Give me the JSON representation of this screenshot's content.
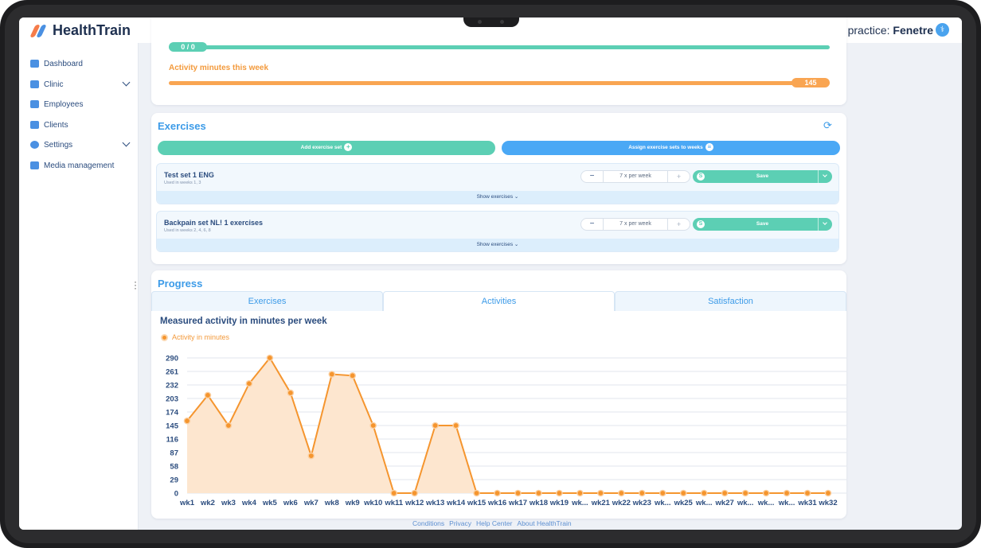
{
  "app": {
    "name": "HealthTrain"
  },
  "practice": {
    "label": "practice:",
    "name": "Fenetre"
  },
  "sidebar": {
    "items": [
      {
        "label": "Dashboard",
        "icon": "dashboard-icon"
      },
      {
        "label": "Clinic",
        "icon": "clinic-icon",
        "expandable": true
      },
      {
        "label": "Employees",
        "icon": "employees-icon"
      },
      {
        "label": "Clients",
        "icon": "clients-icon"
      },
      {
        "label": "Settings",
        "icon": "gear-icon",
        "expandable": true
      },
      {
        "label": "Media management",
        "icon": "media-icon"
      }
    ]
  },
  "goals": {
    "exercise_pill": "0 / 0",
    "exercise_progress": 0,
    "activity_label": "Activity minutes this week",
    "activity_pill": "145",
    "activity_progress": 1
  },
  "exercises": {
    "title": "Exercises",
    "add_label": "Add exercise set",
    "assign_label": "Assign exercise sets to weeks",
    "sets": [
      {
        "name": "Test set 1 ENG",
        "weeks": "Used in weeks 1, 3",
        "frequency": "7 x per week",
        "save_label": "Save",
        "show_label": "Show exercises"
      },
      {
        "name": "Backpain set NL! 1 exercises",
        "weeks": "Used in weeks 2, 4, 6, 8",
        "frequency": "7 x per week",
        "save_label": "Save",
        "show_label": "Show exercises"
      }
    ]
  },
  "progress": {
    "title": "Progress",
    "tabs": [
      {
        "label": "Exercises",
        "active": false
      },
      {
        "label": "Activities",
        "active": true
      },
      {
        "label": "Satisfaction",
        "active": false
      }
    ]
  },
  "chart_data": {
    "type": "area",
    "title": "Measured activity in minutes per week",
    "legend": "Activity in minutes",
    "color": "#f5952e",
    "fill": "#fde6cf",
    "yticks": [
      0,
      29,
      58,
      87,
      116,
      145,
      174,
      203,
      232,
      261,
      290
    ],
    "ylim": [
      0,
      290
    ],
    "grid": true,
    "x": [
      "wk1",
      "wk2",
      "wk3",
      "wk4",
      "wk5",
      "wk6",
      "wk7",
      "wk8",
      "wk9",
      "wk10",
      "wk11",
      "wk12",
      "wk13",
      "wk14",
      "wk15",
      "wk16",
      "wk17",
      "wk18",
      "wk19",
      "wk...",
      "wk21",
      "wk22",
      "wk23",
      "wk...",
      "wk25",
      "wk...",
      "wk27",
      "wk...",
      "wk...",
      "wk...",
      "wk31",
      "wk32"
    ],
    "values": [
      155,
      210,
      145,
      235,
      290,
      215,
      80,
      255,
      252,
      145,
      0,
      0,
      145,
      145,
      0,
      0,
      0,
      0,
      0,
      0,
      0,
      0,
      0,
      0,
      0,
      0,
      0,
      0,
      0,
      0,
      0,
      0
    ]
  },
  "footer": {
    "links": [
      "Conditions",
      "Privacy",
      "Help Center",
      "About HealthTrain"
    ]
  }
}
